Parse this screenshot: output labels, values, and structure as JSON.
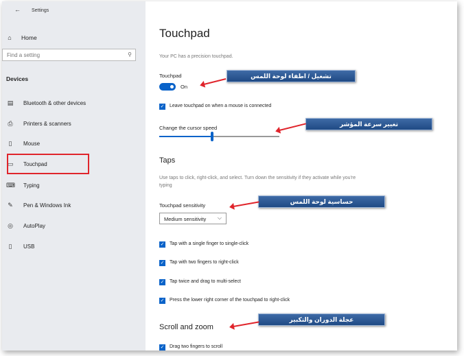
{
  "window": {
    "title": "Settings",
    "back_icon": "arrow-left-icon"
  },
  "sidebar": {
    "home_label": "Home",
    "search_placeholder": "Find a setting",
    "section_title": "Devices",
    "items": [
      {
        "label": "Bluetooth & other devices",
        "icon": "bluetooth-devices-icon"
      },
      {
        "label": "Printers & scanners",
        "icon": "printer-icon"
      },
      {
        "label": "Mouse",
        "icon": "mouse-icon"
      },
      {
        "label": "Touchpad",
        "icon": "touchpad-icon",
        "selected": true
      },
      {
        "label": "Typing",
        "icon": "keyboard-icon"
      },
      {
        "label": "Pen & Windows Ink",
        "icon": "pen-icon"
      },
      {
        "label": "AutoPlay",
        "icon": "autoplay-icon"
      },
      {
        "label": "USB",
        "icon": "usb-icon"
      }
    ]
  },
  "main": {
    "title": "Touchpad",
    "subtitle": "Your PC has a precision touchpad.",
    "touchpad_label": "Touchpad",
    "toggle_state": "On",
    "leave_on_label": "Leave touchpad on when a mouse is connected",
    "cursor_speed_label": "Change the cursor speed",
    "cursor_speed_fraction": 0.44,
    "taps_heading": "Taps",
    "taps_desc": "Use taps to click, right-click, and select. Turn down the sensitivity if they activate while you're typing",
    "sensitivity_label": "Touchpad sensitivity",
    "sensitivity_value": "Medium sensitivity",
    "tap_options": [
      "Tap with a single finger to single-click",
      "Tap with two fingers to right-click",
      "Tap twice and drag to multi-select",
      "Press the lower right corner of the touchpad to right-click"
    ],
    "scroll_heading": "Scroll and zoom",
    "scroll_option": "Drag two fingers to scroll"
  },
  "callouts": {
    "toggle": "تشغيل / اطفاء لوحة اللمس",
    "speed": "تغيير سرعة المؤشر",
    "sensitivity": "حساسية لوحة اللمس",
    "scroll": "عجلة الدوران والتكبير"
  },
  "colors": {
    "accent": "#0a63c9",
    "highlight": "#e0242b",
    "callout": "#2a5592"
  }
}
